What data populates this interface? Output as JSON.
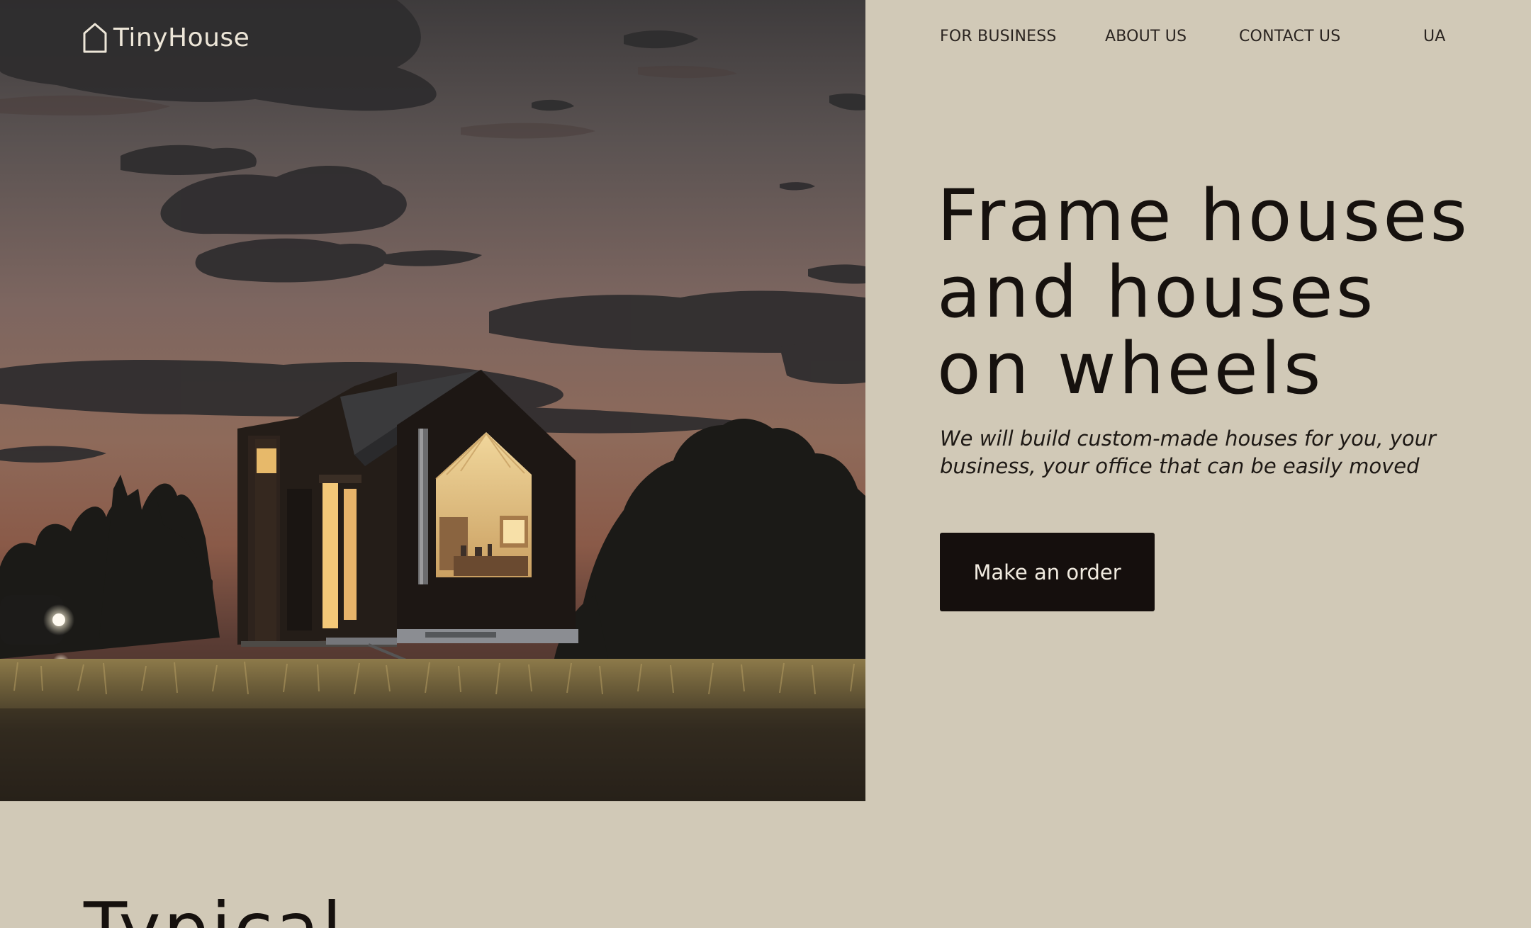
{
  "brand": {
    "name": "TinyHouse",
    "icon": "house-outline-icon"
  },
  "nav": {
    "items": [
      {
        "label": "FOR BUSINESS"
      },
      {
        "label": "ABOUT US"
      },
      {
        "label": "CONTACT US"
      },
      {
        "label": "UA"
      }
    ]
  },
  "hero": {
    "headline_lines": [
      "Frame houses",
      "and houses",
      "on wheels"
    ],
    "subtitle": "We will build custom-made houses for you, your business, your office that can be easily moved",
    "cta_label": "Make an order"
  },
  "next_section": {
    "heading_partial": "Typical"
  },
  "colors": {
    "page_background": "#d1c9b7",
    "text_dark": "#16110e",
    "button_background": "#150f0d",
    "button_text": "#f1ebe0",
    "logo_text": "#ede6d8"
  }
}
